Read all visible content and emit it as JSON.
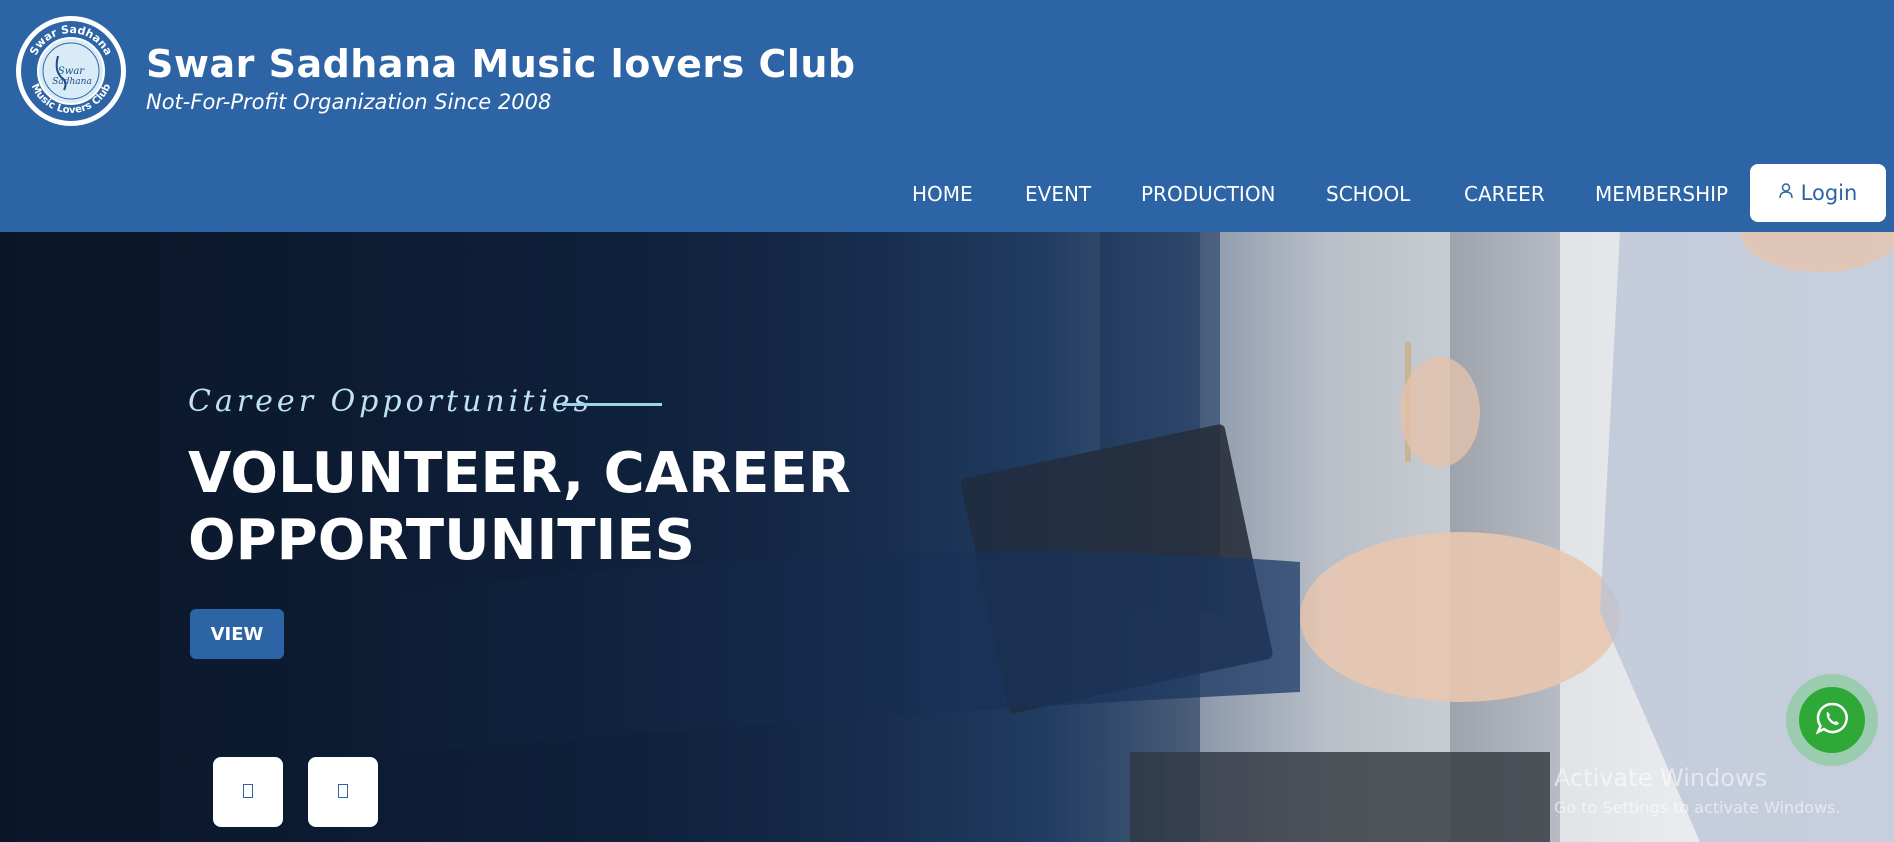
{
  "brand": {
    "logo_text_top": "Swar Sadhana",
    "logo_text_bottom": "Music Lovers Club",
    "logo_inner": "Swar Sadhana",
    "title": "Swar Sadhana Music lovers Club",
    "subtitle": "Not-For-Profit Organization Since 2008"
  },
  "nav": {
    "items": [
      {
        "label": "HOME"
      },
      {
        "label": "EVENT"
      },
      {
        "label": "PRODUCTION"
      },
      {
        "label": "SCHOOL"
      },
      {
        "label": "CAREER"
      },
      {
        "label": "MEMBERSHIP"
      }
    ],
    "login_label": "Login",
    "login_icon": "user-icon"
  },
  "hero": {
    "eyebrow": "Career Opportunities",
    "title": "VOLUNTEER, CAREER OPPORTUNITIES",
    "view_label": "VIEW",
    "prev_icon": "arrow-left-icon",
    "next_icon": "arrow-right-icon"
  },
  "floating": {
    "whatsapp_icon": "whatsapp-icon"
  },
  "watermark": {
    "title": "Activate Windows",
    "subtitle": "Go to Settings to activate Windows."
  },
  "colors": {
    "header_bg": "#2c64a6",
    "accent_light": "#bfe3f1",
    "whatsapp": "#2ea836"
  }
}
